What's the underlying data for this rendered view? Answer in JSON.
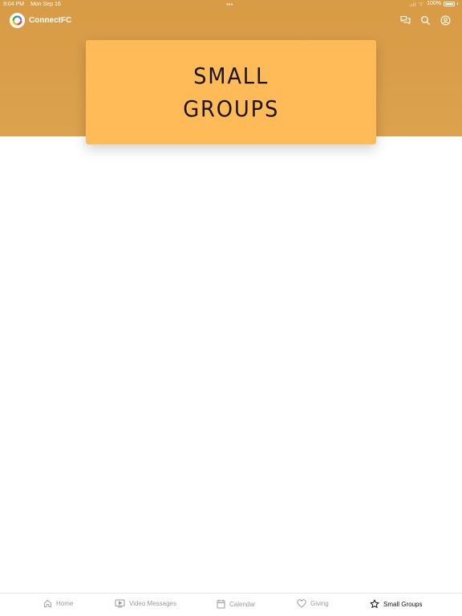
{
  "status_bar": {
    "time": "9:04 PM",
    "date": "Mon Sep 16",
    "battery_text": "100%",
    "battery_level": 1.0
  },
  "header": {
    "app_name": "ConnectFC",
    "logo_icon": "connectfc-logo",
    "actions": [
      {
        "icon": "chat-icon"
      },
      {
        "icon": "search-icon"
      },
      {
        "icon": "account-icon"
      }
    ]
  },
  "banner": {
    "line1": "SMALL",
    "line2": "GROUPS"
  },
  "tabs": [
    {
      "label": "Home",
      "icon": "home-icon",
      "active": false
    },
    {
      "label": "Video Messages",
      "icon": "video-icon",
      "active": false
    },
    {
      "label": "Calendar",
      "icon": "calendar-icon",
      "active": false
    },
    {
      "label": "Giving",
      "icon": "heart-icon",
      "active": false
    },
    {
      "label": "Small Groups",
      "icon": "star-icon",
      "active": true
    }
  ],
  "colors": {
    "header_bg": "#d89b46",
    "card_bg": "#febb58",
    "active_tab": "#111111",
    "inactive_tab": "#9a9a9a"
  }
}
